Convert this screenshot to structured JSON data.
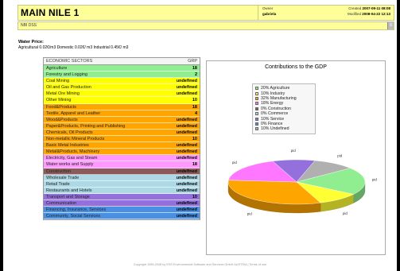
{
  "header": {
    "title": "MAIN NILE 1",
    "owner_label": "Owner",
    "owner": "gabriela",
    "created_label": "Created",
    "created": "2007-09-11 08:08",
    "modified_label": "Modified",
    "modified": "2008-04-22 12:13"
  },
  "subbar": {
    "text": "NBI DSS",
    "button": "≡"
  },
  "water_price": {
    "title": "Water Price:",
    "line": "Agricultural  0.02€/m3   Domestic  0.02€/ m3   Industrial  0.45€/ m3"
  },
  "sectors": {
    "header_name": "ECONOMIC SECTORS",
    "header_value": "GRP",
    "rows": [
      {
        "name": "Agriculture",
        "value": "18",
        "color": "#90ee90"
      },
      {
        "name": "Forestry and Logging",
        "value": "2",
        "color": "#90ee90"
      },
      {
        "name": "Coal Mining",
        "value": "undefined",
        "color": "#ffff00"
      },
      {
        "name": "Oil and Gas Production",
        "value": "undefined",
        "color": "#ffff00"
      },
      {
        "name": "Metal Ore Mining",
        "value": "undefined",
        "color": "#ffff00"
      },
      {
        "name": "Other Mining",
        "value": "10",
        "color": "#ffff00"
      },
      {
        "name": "Food&Products",
        "value": "18",
        "color": "#ffa500"
      },
      {
        "name": "Textile, Apparel and Leather",
        "value": "4",
        "color": "#ffa500"
      },
      {
        "name": "Wood&Products",
        "value": "undefined",
        "color": "#ffa500"
      },
      {
        "name": "Paper&Products, Printing and Publishing",
        "value": "undefined",
        "color": "#ffa500"
      },
      {
        "name": "Chemicals, Oil Products",
        "value": "undefined",
        "color": "#ffa500"
      },
      {
        "name": "Non-metallic Mineral Products",
        "value": "10",
        "color": "#ffa500"
      },
      {
        "name": "Basic Metal Industries",
        "value": "undefined",
        "color": "#ffa500"
      },
      {
        "name": "Metal&Products, Machinery",
        "value": "undefined",
        "color": "#ffa500"
      },
      {
        "name": "Electricity, Gas and Steam",
        "value": "undefined",
        "color": "#ff99ff"
      },
      {
        "name": "Water works and Supply",
        "value": "18",
        "color": "#ff99ff"
      },
      {
        "name": "Construction",
        "value": "undefined",
        "color": "#8b5a5a"
      },
      {
        "name": "Wholesale Trade",
        "value": "undefined",
        "color": "#add8e6"
      },
      {
        "name": "Retail Trade",
        "value": "undefined",
        "color": "#add8e6"
      },
      {
        "name": "Restaurants and Hotels",
        "value": "undefined",
        "color": "#add8e6"
      },
      {
        "name": "Transport and Storage",
        "value": "10",
        "color": "#9370db"
      },
      {
        "name": "Communication",
        "value": "undefined",
        "color": "#9370db"
      },
      {
        "name": "Financing, Insurance, Services",
        "value": "undefined",
        "color": "#4a90e2"
      },
      {
        "name": "Community, Social Services",
        "value": "undefined",
        "color": "#4a90e2"
      }
    ]
  },
  "chart_data": {
    "type": "pie",
    "title": "Contributions to the GDP",
    "slice_labels": [
      "pid",
      "pid",
      "pid",
      "pid",
      "pid",
      "pid",
      "pid",
      "pid"
    ],
    "series": [
      {
        "name": "Agriculture",
        "legend": "20% Agriculture",
        "value": 20,
        "color": "#90ee90"
      },
      {
        "name": "Industry",
        "legend": "10% Industry",
        "value": 10,
        "color": "#ffff33"
      },
      {
        "name": "Manufacturing",
        "legend": "32% Manufacturing",
        "value": 32,
        "color": "#ffa500"
      },
      {
        "name": "Energy",
        "legend": "18% Energy",
        "value": 18,
        "color": "#ff77ff"
      },
      {
        "name": "Construction",
        "legend": "0% Construction",
        "value": 0,
        "color": "#8b5a5a"
      },
      {
        "name": "Commerce",
        "legend": "0% Commerce",
        "value": 0,
        "color": "#add8e6"
      },
      {
        "name": "Service",
        "legend": "10% Service",
        "value": 10,
        "color": "#9370db"
      },
      {
        "name": "Finance",
        "legend": "0% Finance",
        "value": 0,
        "color": "#4a90e2"
      },
      {
        "name": "Undefined",
        "legend": "10% Undefined",
        "value": 10,
        "color": "#b0b0b0"
      }
    ]
  },
  "footer": {
    "text": "Copyright 1995-2008 by   ESS  Environmental Software and Services GmbH AUSTRIA | Terms of use"
  }
}
